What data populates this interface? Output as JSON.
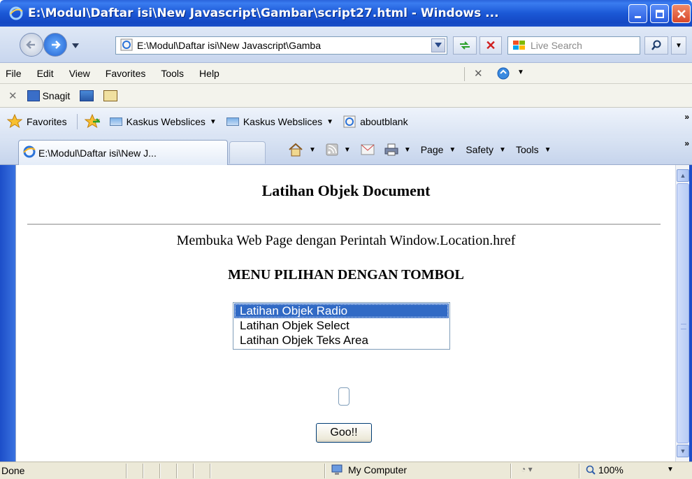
{
  "window": {
    "title": "E:\\Modul\\Daftar isi\\New Javascript\\Gambar\\script27.html - Windows ..."
  },
  "address_bar": {
    "url": "E:\\Modul\\Daftar isi\\New Javascript\\Gamba",
    "search_placeholder": "Live Search"
  },
  "menu": {
    "items": [
      "File",
      "Edit",
      "View",
      "Favorites",
      "Tools",
      "Help"
    ]
  },
  "snagit_bar": {
    "label": "Snagit"
  },
  "favorites_bar": {
    "favorites_label": "Favorites",
    "items": [
      "Kaskus Webslices",
      "Kaskus Webslices",
      "aboutblank"
    ]
  },
  "tab": {
    "label": "E:\\Modul\\Daftar isi\\New J..."
  },
  "command_bar": {
    "page": "Page",
    "safety": "Safety",
    "tools": "Tools"
  },
  "page": {
    "title": "Latihan Objek Document",
    "subtitle": "Membuka Web Page dengan Perintah Window.Location.href",
    "menu_heading": "MENU PILIHAN DENGAN TOMBOL",
    "options": [
      "Latihan Objek Radio",
      "Latihan Objek Select",
      "Latihan Objek Teks Area"
    ],
    "selected_option": "Latihan Objek Radio",
    "text_input_value": "",
    "go_button": "Goo!!"
  },
  "status_bar": {
    "text": "Done",
    "zone": "My Computer",
    "zoom": "100%"
  },
  "colors": {
    "titlebar": "#1b58d6",
    "selection": "#316ac5",
    "statusbar": "#ece9d8"
  }
}
